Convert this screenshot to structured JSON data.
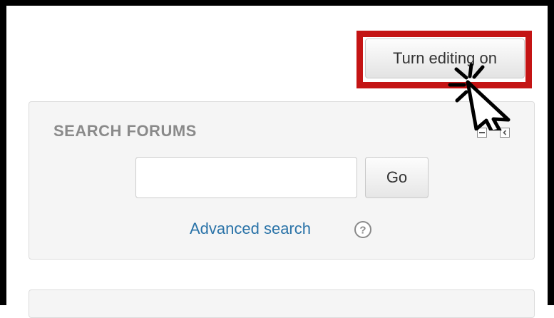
{
  "header": {
    "edit_button_label": "Turn editing on",
    "highlight_color": "#c41414"
  },
  "search_block": {
    "title": "SEARCH FORUMS",
    "input_value": "",
    "go_label": "Go",
    "advanced_link": "Advanced search",
    "icons": [
      "minus-icon",
      "chevron-left-icon",
      "help-icon"
    ],
    "link_color": "#2a73a8"
  },
  "cursor": {
    "icon": "pointer-cursor-icon"
  }
}
